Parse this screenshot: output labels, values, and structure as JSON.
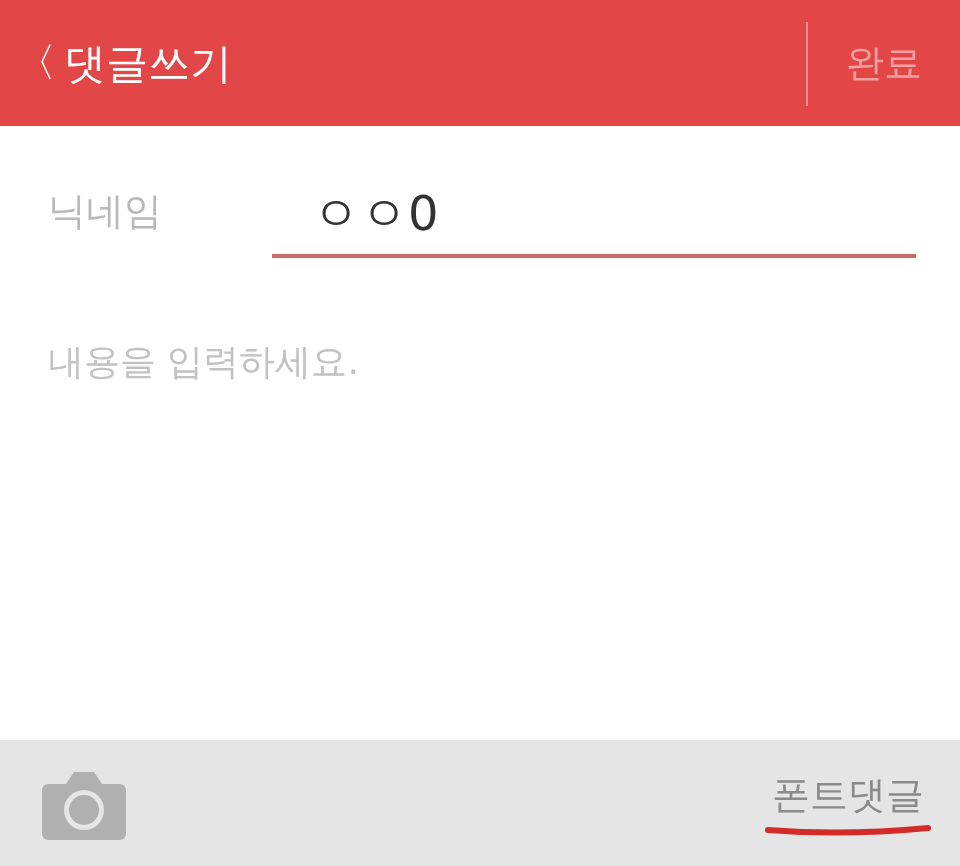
{
  "header": {
    "back": "〈",
    "title": "댓글쓰기",
    "done": "완료"
  },
  "nickname": {
    "label": "닉네임",
    "value": "ㅇㅇ0"
  },
  "content": {
    "placeholder": "내용을 입력하세요."
  },
  "bottom_bar": {
    "font_comment": "폰트댓글"
  }
}
